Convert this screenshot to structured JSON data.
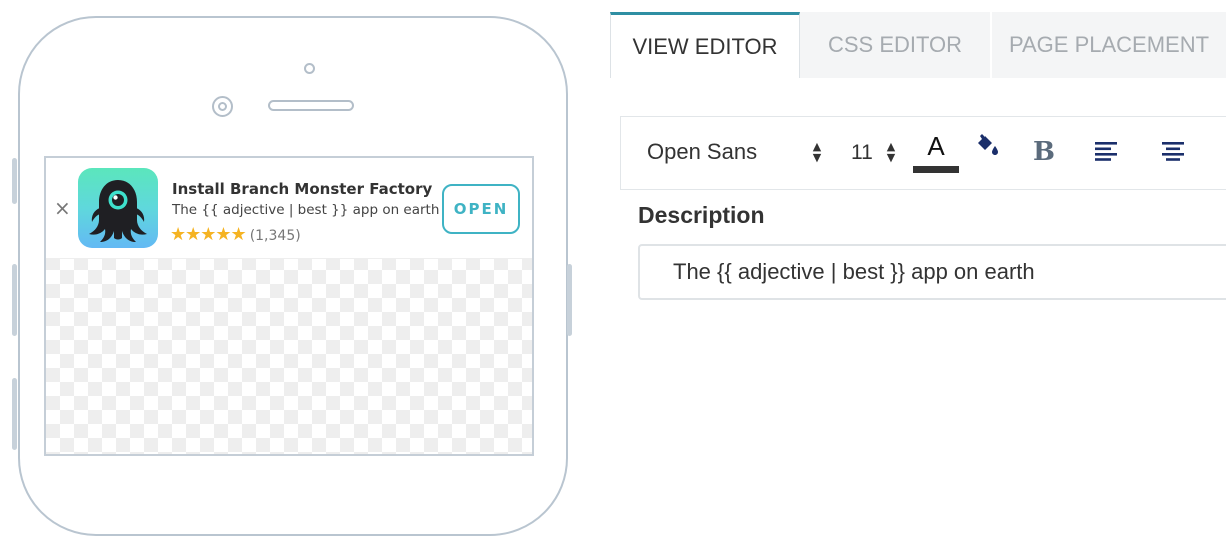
{
  "preview": {
    "banner": {
      "close_glyph": "×",
      "app_title": "Install Branch Monster Factory",
      "description": "The {{ adjective | best }} app on earth",
      "stars": "★★★★★",
      "rating_count": "(1,345)",
      "open_label": "OPEN",
      "icon": "branch-monster-app-icon",
      "accent_color": "#3fb3c4",
      "star_color": "#f5b322"
    }
  },
  "editor": {
    "tabs": [
      {
        "label": "VIEW EDITOR",
        "active": true
      },
      {
        "label": "CSS EDITOR",
        "active": false
      },
      {
        "label": "PAGE PLACEMENT",
        "active": false
      }
    ],
    "toolbar": {
      "font_family": "Open Sans",
      "font_size": "11",
      "text_color_glyph": "A",
      "text_color": "#333333",
      "bold_glyph": "B",
      "icons": [
        "font-family-stepper-icon",
        "font-size-stepper-icon",
        "text-color-icon",
        "fill-color-icon",
        "bold-icon",
        "align-left-icon",
        "align-center-icon"
      ]
    },
    "description": {
      "label": "Description",
      "value": "The {{ adjective | best }} app on earth"
    }
  }
}
